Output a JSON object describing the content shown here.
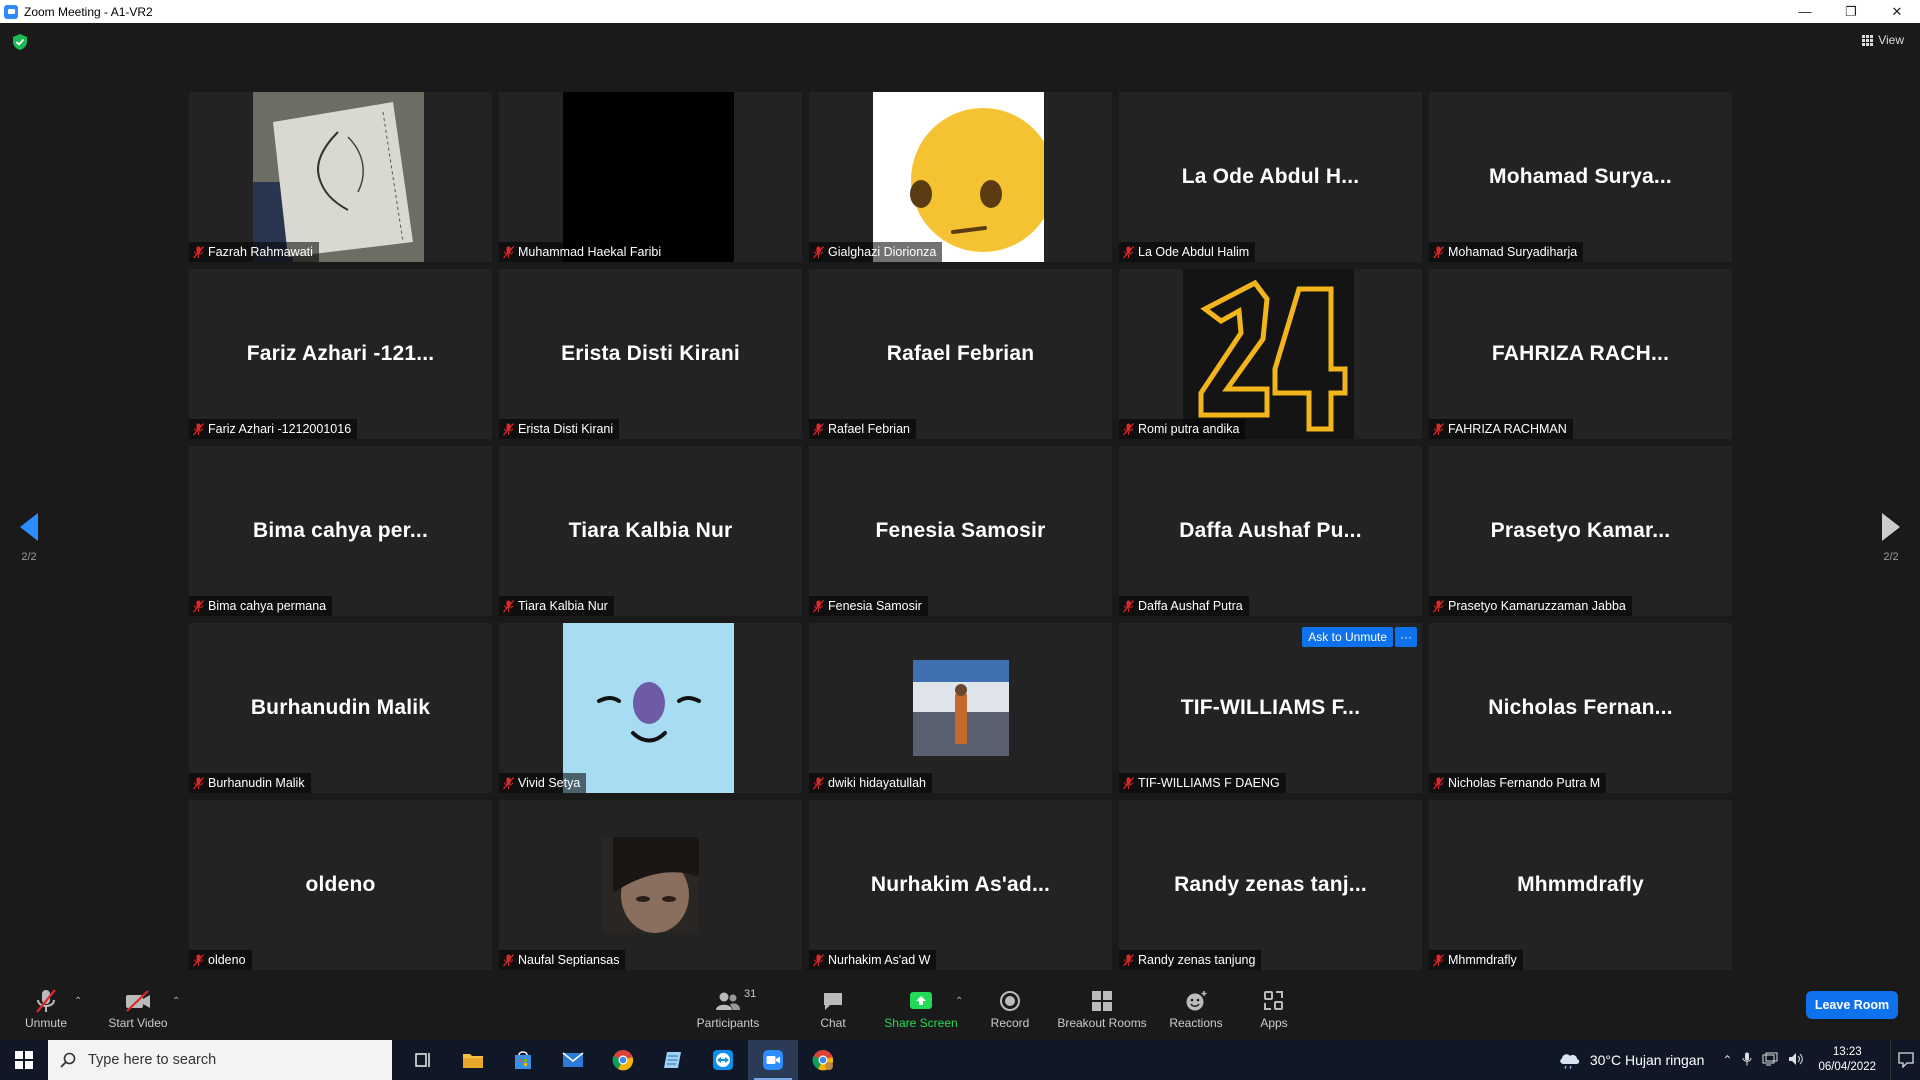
{
  "window": {
    "title": "Zoom Meeting - A1-VR2",
    "minimize": "—",
    "restore": "❐",
    "close": "✕"
  },
  "header": {
    "view_label": "View"
  },
  "pagination": {
    "prev_page": "2/2",
    "next_page": "2/2"
  },
  "tiles": [
    {
      "big": "",
      "name": "Fazrah Rahmawati",
      "pic": "sketch"
    },
    {
      "big": "",
      "name": "Muhammad Haekal Faribi",
      "pic": "black"
    },
    {
      "big": "",
      "name": "Gialghazi Diorionza",
      "pic": "emoji"
    },
    {
      "big": "La Ode Abdul H...",
      "name": "La Ode Abdul Halim"
    },
    {
      "big": "Mohamad  Surya...",
      "name": "Mohamad Suryadiharja"
    },
    {
      "big": "Fariz Azhari -121...",
      "name": "Fariz Azhari -1212001016"
    },
    {
      "big": "Erista Disti Kirani",
      "name": "Erista Disti Kirani"
    },
    {
      "big": "Rafael Febrian",
      "name": "Rafael Febrian"
    },
    {
      "big": "",
      "name": "Romi putra andika",
      "pic": "24"
    },
    {
      "big": "FAHRIZA  RACH...",
      "name": "FAHRIZA RACHMAN"
    },
    {
      "big": "Bima cahya per...",
      "name": "Bima cahya permana"
    },
    {
      "big": "Tiara Kalbia Nur",
      "name": "Tiara Kalbia Nur"
    },
    {
      "big": "Fenesia Samosir",
      "name": "Fenesia Samosir"
    },
    {
      "big": "Daffa Aushaf Pu...",
      "name": "Daffa Aushaf Putra"
    },
    {
      "big": "Prasetyo Kamar...",
      "name": "Prasetyo Kamaruzzaman Jabba"
    },
    {
      "big": "Burhanudin Malik",
      "name": "Burhanudin Malik"
    },
    {
      "big": "",
      "name": "Vivid Setya",
      "pic": "face"
    },
    {
      "big": "",
      "name": "dwiki hidayatullah",
      "pic": "photo"
    },
    {
      "big": "TIF-WILLIAMS  F...",
      "name": "TIF-WILLIAMS F DAENG",
      "ask_unmute": "Ask to Unmute",
      "more": "···"
    },
    {
      "big": "Nicholas  Fernan...",
      "name": "Nicholas Fernando Putra M"
    },
    {
      "big": "oldeno",
      "name": "oldeno"
    },
    {
      "big": "",
      "name": "Naufal Septiansas",
      "pic": "dark"
    },
    {
      "big": "Nurhakim  As'ad...",
      "name": "Nurhakim As'ad W"
    },
    {
      "big": "Randy zenas tanj...",
      "name": "Randy zenas tanjung"
    },
    {
      "big": "Mhmmdrafly",
      "name": "Mhmmdrafly"
    }
  ],
  "toolbar": {
    "unmute": "Unmute",
    "start_video": "Start Video",
    "participants": "Participants",
    "participants_count": "31",
    "chat": "Chat",
    "share_screen": "Share Screen",
    "record": "Record",
    "breakout_rooms": "Breakout Rooms",
    "reactions": "Reactions",
    "apps": "Apps",
    "leave": "Leave Room",
    "share_color": "#23d959"
  },
  "taskbar": {
    "search_placeholder": "Type here to search",
    "weather": "30°C  Hujan ringan",
    "time": "13:23",
    "date": "06/04/2022"
  }
}
